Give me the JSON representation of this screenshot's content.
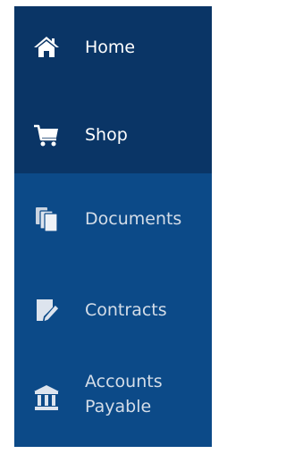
{
  "sidebar": {
    "items": [
      {
        "label": "Home",
        "icon": "home-icon"
      },
      {
        "label": "Shop",
        "icon": "shopping-cart-icon"
      },
      {
        "label": "Documents",
        "icon": "documents-icon"
      },
      {
        "label": "Contracts",
        "icon": "contract-edit-icon"
      },
      {
        "label_line1": "Accounts",
        "label_line2": "Payable",
        "icon": "bank-icon"
      }
    ]
  },
  "colors": {
    "active_bg": "#0a3566",
    "inactive_bg": "#0c4a88",
    "active_text": "#ffffff",
    "inactive_text": "#d4dde8"
  }
}
